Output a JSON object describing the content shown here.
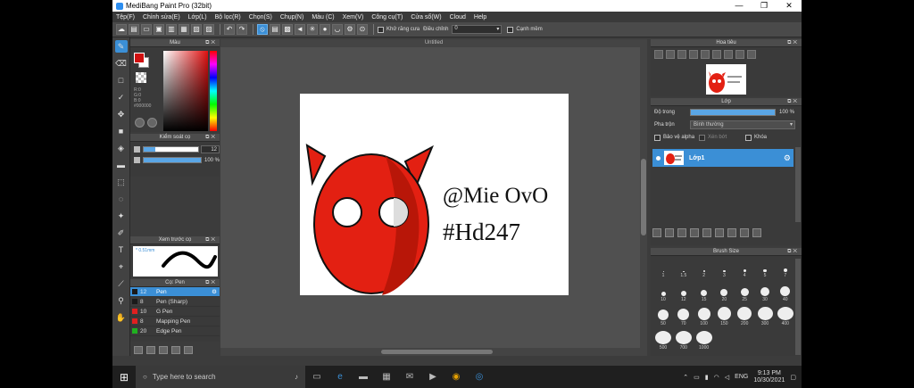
{
  "title": "MediBang Paint Pro (32bit)",
  "window_controls": [
    "—",
    "❐",
    "✕"
  ],
  "menu": [
    "Tệp(F)",
    "Chỉnh sửa(E)",
    "Lớp(L)",
    "Bộ lọc(R)",
    "Chọn(S)",
    "Chụp(N)",
    "Màu (C)",
    "Xem(V)",
    "Công cụ(T)",
    "Cửa sổ(W)",
    "Cloud",
    "Help"
  ],
  "toolbar": {
    "antialias_label": "Khử răng cưa",
    "correction_label": "Điều chỉnh",
    "correction_value": "0",
    "snap_label": "Cạnh mềm"
  },
  "panels": {
    "color_title": "Màu",
    "color_values": {
      "r": "R:0",
      "g": "G:0",
      "b": "B:0",
      "hex": "#000000"
    },
    "brush_control_title": "Kiểm soát cọ",
    "brush_size_value": "12",
    "opacity_value": "100 %",
    "preview_title": "Xem trước cọ",
    "preview_size_label": "* 0.51mm",
    "pen_title": "Cọ: Pen",
    "brushes": [
      {
        "size": "12",
        "name": "Pen",
        "color": "#1a1a1a"
      },
      {
        "size": "8",
        "name": "Pen (Sharp)",
        "color": "#1a1a1a"
      },
      {
        "size": "10",
        "name": "G Pen",
        "color": "#e02020"
      },
      {
        "size": "8",
        "name": "Mapping Pen",
        "color": "#e02020"
      },
      {
        "size": "20",
        "name": "Edge Pen",
        "color": "#20b020"
      }
    ],
    "navigator_title": "Hoa tiêu",
    "layer_title": "Lớp",
    "layer_opacity_label": "Độ trong",
    "layer_opacity_value": "100 %",
    "blend_label": "Pha trộn",
    "blend_value": "Bình thường",
    "protect_alpha_label": "Bảo vệ alpha",
    "clipping_label": "Xén bớt",
    "lock_label": "Khóa",
    "layer_name": "Lớp1",
    "brushsize_title": "Brush Size",
    "brush_sizes": [
      "1",
      "1.5",
      "2",
      "3",
      "4",
      "5",
      "7",
      "10",
      "12",
      "15",
      "20",
      "25",
      "30",
      "40",
      "50",
      "70",
      "100",
      "150",
      "200",
      "300",
      "400",
      "500",
      "700",
      "1000"
    ]
  },
  "document_tab": "Untitled",
  "canvas_text": {
    "line1": "@Mie OvO",
    "line2": "#Hd247"
  },
  "taskbar": {
    "search_placeholder": "Type here to search",
    "language": "ENG",
    "time": "9:13 PM",
    "date": "10/30/2021"
  },
  "colors": {
    "accent": "#3b8fd6",
    "devil": "#e32012"
  }
}
